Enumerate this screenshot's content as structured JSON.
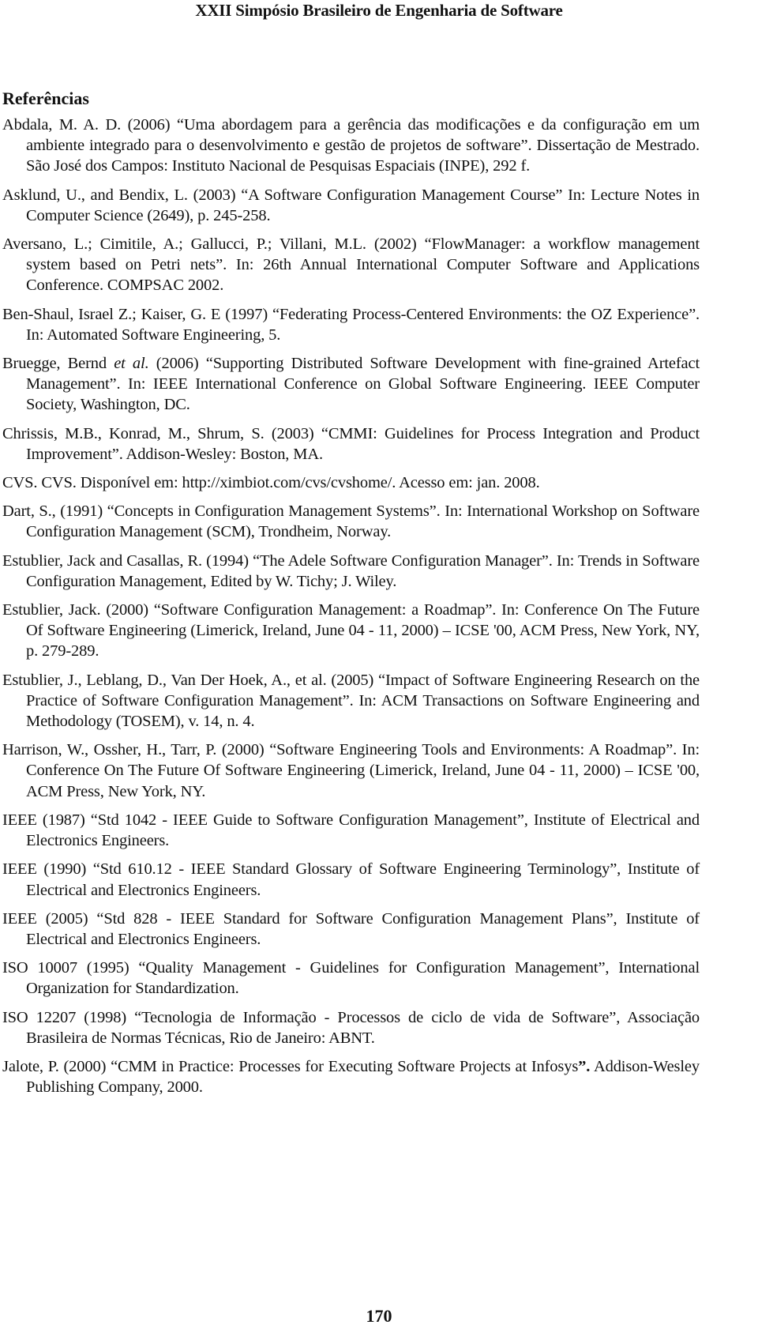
{
  "header": {
    "running_title": "XXII Simpósio Brasileiro de Engenharia de Software"
  },
  "section": {
    "title": "Referências"
  },
  "references": [
    {
      "text": "Abdala, M. A. D. (2006) “Uma abordagem para a gerência das modificações e da configuração em um ambiente integrado para o desenvolvimento e gestão de projetos de software”. Dissertação de Mestrado. São José dos Campos: Instituto Nacional de Pesquisas Espaciais (INPE), 292 f."
    },
    {
      "text": "Asklund, U., and Bendix, L. (2003) “A Software Configuration Management Course” In: Lecture Notes in Computer Science (2649), p. 245-258."
    },
    {
      "text": "Aversano, L.; Cimitile, A.; Gallucci, P.; Villani, M.L. (2002) “FlowManager: a workflow management system based on Petri nets”. In: 26th Annual International Computer Software and Applications Conference. COMPSAC 2002."
    },
    {
      "text": "Ben-Shaul, Israel Z.; Kaiser, G. E (1997) “Federating Process-Centered Environments: the OZ Experience”. In: Automated Software Engineering, 5."
    },
    {
      "text_before": "Bruegge, Bernd ",
      "italic": "et al.",
      "text_after": " (2006) “Supporting Distributed Software Development with fine-grained Artefact Management”. In: IEEE International Conference on Global Software Engineering. IEEE Computer Society, Washington, DC."
    },
    {
      "text": "Chrissis, M.B., Konrad, M., Shrum, S. (2003) “CMMI: Guidelines for Process Integration and Product Improvement”. Addison-Wesley: Boston, MA."
    },
    {
      "text": "CVS. CVS. Disponível em: http://ximbiot.com/cvs/cvshome/. Acesso em: jan. 2008."
    },
    {
      "text": "Dart, S., (1991) “Concepts in Configuration Management Systems”. In: International Workshop on Software Configuration Management (SCM), Trondheim, Norway."
    },
    {
      "text": "Estublier, Jack and Casallas, R. (1994) “The Adele Software Configuration Manager”. In: Trends in Software Configuration Management, Edited by W. Tichy; J. Wiley."
    },
    {
      "text": "Estublier, Jack. (2000) “Software Configuration Management: a Roadmap”. In: Conference On The Future Of Software Engineering (Limerick, Ireland, June 04 - 11, 2000) – ICSE '00, ACM Press, New York, NY, p. 279-289."
    },
    {
      "text": "Estublier, J., Leblang, D., Van Der Hoek, A., et al. (2005) “Impact of Software Engineering Research on the Practice of Software Configuration Management”. In: ACM Transactions on Software Engineering and Methodology (TOSEM), v. 14, n. 4."
    },
    {
      "text": "Harrison, W., Ossher, H., Tarr, P. (2000) “Software Engineering Tools and Environments: A Roadmap”. In: Conference On The Future Of Software Engineering (Limerick, Ireland, June 04 - 11, 2000) – ICSE '00, ACM Press, New York, NY."
    },
    {
      "text": "IEEE (1987) “Std 1042 - IEEE Guide to Software Configuration Management”, Institute of Electrical and Electronics Engineers."
    },
    {
      "text": "IEEE (1990) “Std 610.12 - IEEE Standard Glossary of Software Engineering Terminology”, Institute of Electrical and Electronics Engineers."
    },
    {
      "text": "IEEE (2005) “Std 828 - IEEE Standard for Software Configuration Management Plans”, Institute of Electrical and Electronics Engineers."
    },
    {
      "text": "ISO 10007 (1995) “Quality Management - Guidelines for Configuration Management”, International Organization for Standardization."
    },
    {
      "text": "ISO 12207 (1998) “Tecnologia de Informação - Processos de ciclo de vida de Software”, Associação Brasileira de Normas Técnicas, Rio de Janeiro: ABNT."
    },
    {
      "text_before": "Jalote, P. (2000) “CMM in Practice: Processes for Executing Software Projects at Infosys",
      "bold": "”.",
      "text_after": " Addison-Wesley Publishing Company, 2000."
    }
  ],
  "footer": {
    "page_number": "170"
  }
}
